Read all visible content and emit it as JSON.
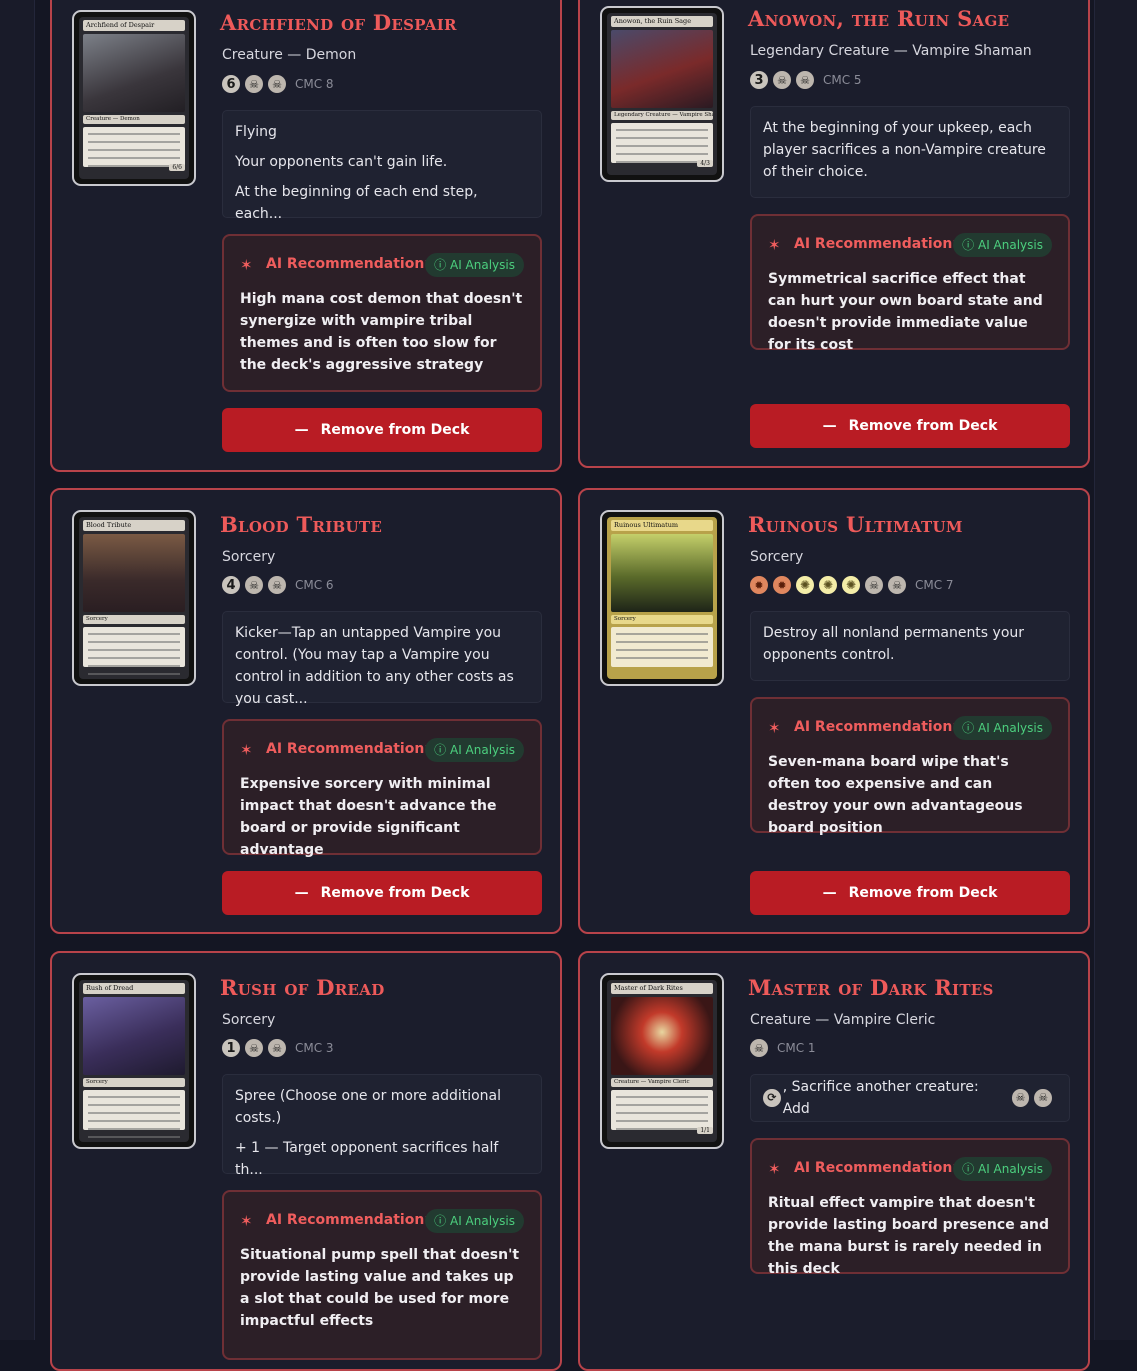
{
  "cards": [
    {
      "name": "Archfiend of Despair",
      "type": "Creature — Demon",
      "mana": [
        "6",
        "B",
        "B"
      ],
      "cmc": "CMC 8",
      "text": [
        "Flying",
        "Your opponents can't gain life.",
        "At the beginning of each end step, each..."
      ],
      "recommendation": "High mana cost demon that doesn't synergize with vampire tribal themes and is often too slow for the deck's aggressive strategy",
      "thumb": {
        "name": "Archfiend of Despair",
        "type": "Creature — Demon",
        "pt": "6/6"
      },
      "art_colors": [
        "#6b6f75",
        "#2d2a2f"
      ]
    },
    {
      "name": "Anowon, the Ruin Sage",
      "type": "Legendary Creature — Vampire Shaman",
      "mana": [
        "3",
        "B",
        "B"
      ],
      "cmc": "CMC 5",
      "text": [
        "At the beginning of your upkeep, each player sacrifices a non-Vampire creature of their choice."
      ],
      "recommendation": "Symmetrical sacrifice effect that can hurt your own board state and doesn't provide immediate value for its cost",
      "thumb": {
        "name": "Anowon, the Ruin Sage",
        "type": "Legendary Creature — Vampire Shaman",
        "pt": "4/3"
      },
      "art_colors": [
        "#7a2a2a",
        "#3a3a5a"
      ]
    },
    {
      "name": "Blood Tribute",
      "type": "Sorcery",
      "mana": [
        "4",
        "B",
        "B"
      ],
      "cmc": "CMC 6",
      "text": [
        "Kicker—Tap an untapped Vampire you control. (You may tap a Vampire you control in addition to any other costs as you cast..."
      ],
      "recommendation": "Expensive sorcery with minimal impact that doesn't advance the board or provide significant advantage",
      "thumb": {
        "name": "Blood Tribute",
        "type": "Sorcery",
        "pt": ""
      },
      "art_colors": [
        "#5c3b33",
        "#2a1e24"
      ]
    },
    {
      "name": "Ruinous Ultimatum",
      "type": "Sorcery",
      "mana": [
        "R",
        "R",
        "W",
        "W",
        "W",
        "B",
        "B"
      ],
      "cmc": "CMC 7",
      "text": [
        "Destroy all nonland permanents your opponents control."
      ],
      "recommendation": "Seven-mana board wipe that's often too expensive and can destroy your own advantageous board position",
      "thumb": {
        "name": "Ruinous Ultimatum",
        "type": "Sorcery",
        "pt": ""
      },
      "art_colors": [
        "#8c9a3a",
        "#2c3020"
      ]
    },
    {
      "name": "Rush of Dread",
      "type": "Sorcery",
      "mana": [
        "1",
        "B",
        "B"
      ],
      "cmc": "CMC 3",
      "text": [
        "Spree (Choose one or more additional costs.)",
        "+ 1 — Target opponent sacrifices half th..."
      ],
      "recommendation": "Situational pump spell that doesn't provide lasting value and takes up a slot that could be used for more impactful effects",
      "thumb": {
        "name": "Rush of Dread",
        "type": "Sorcery",
        "pt": ""
      },
      "art_colors": [
        "#5a4f8a",
        "#221e36"
      ]
    },
    {
      "name": "Master of Dark Rites",
      "type": "Creature — Vampire Cleric",
      "mana": [
        "B"
      ],
      "cmc": "CMC 1",
      "text": [
        ", Sacrifice another creature: Add"
      ],
      "recommendation": "Ritual effect vampire that doesn't provide lasting board presence and the mana burst is rarely needed in this deck",
      "thumb": {
        "name": "Master of Dark Rites",
        "type": "Creature — Vampire Cleric",
        "pt": "1/1"
      },
      "art_colors": [
        "#b02a22",
        "#2a1616"
      ]
    }
  ],
  "labels": {
    "recommendation": "AI Recommendation:",
    "badge": "AI Analysis",
    "remove": "Remove from Deck"
  }
}
